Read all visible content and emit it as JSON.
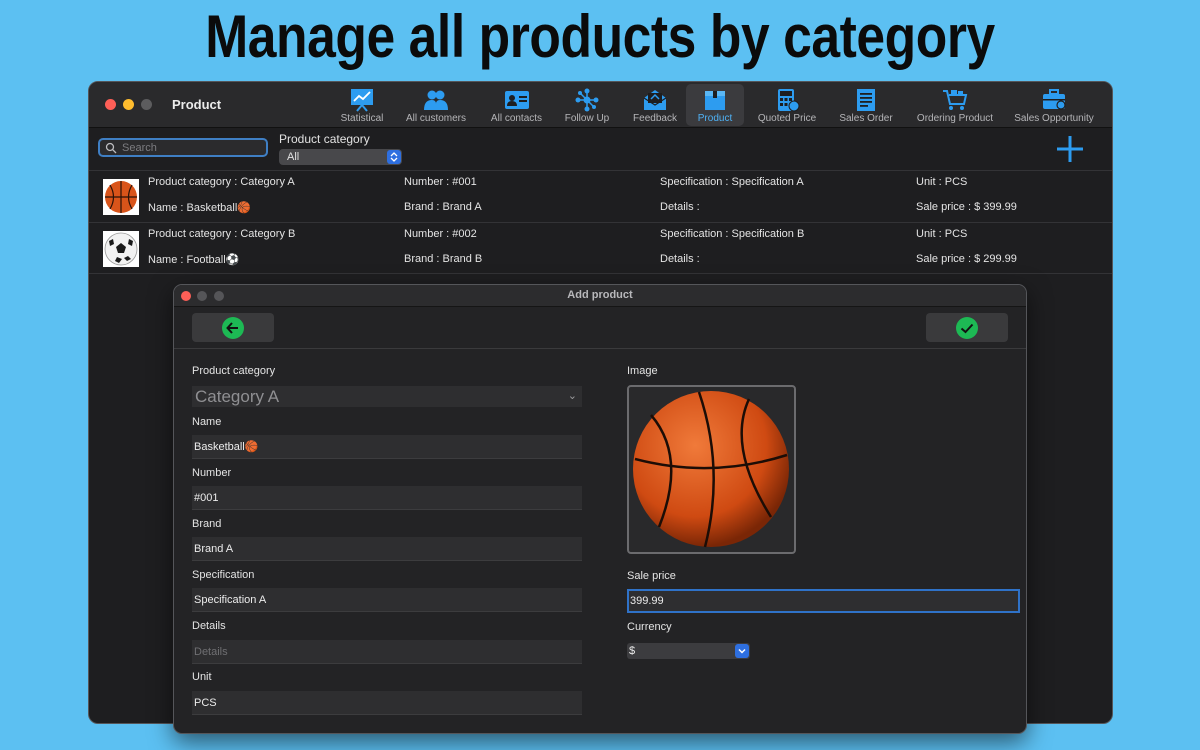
{
  "headline": "Manage all products by category",
  "window": {
    "title": "Product",
    "toolbar": [
      {
        "label": "Statistical",
        "icon": "chart-board-icon"
      },
      {
        "label": "All customers",
        "icon": "customers-icon"
      },
      {
        "label": "All contacts",
        "icon": "contact-card-icon"
      },
      {
        "label": "Follow Up",
        "icon": "network-icon"
      },
      {
        "label": "Feedback",
        "icon": "envelope-icon"
      },
      {
        "label": "Product",
        "icon": "box-icon",
        "active": true
      },
      {
        "label": "Quoted Price",
        "icon": "calculator-icon"
      },
      {
        "label": "Sales Order",
        "icon": "document-list-icon"
      },
      {
        "label": "Ordering Product",
        "icon": "cart-icon"
      },
      {
        "label": "Sales Opportunity",
        "icon": "briefcase-icon"
      }
    ]
  },
  "search": {
    "placeholder": "Search",
    "value": ""
  },
  "filter": {
    "label": "Product category",
    "selected": "All"
  },
  "products": [
    {
      "image": "basketball",
      "category": "Product category : Category A",
      "name": "Name : Basketball🏀",
      "number": "Number : #001",
      "brand": "Brand : Brand A",
      "specification": "Specification : Specification A",
      "details": "Details :",
      "unit": "Unit : PCS",
      "price": "Sale price : $ 399.99"
    },
    {
      "image": "football",
      "category": "Product category : Category B",
      "name": "Name : Football⚽",
      "number": "Number : #002",
      "brand": "Brand : Brand B",
      "specification": "Specification : Specification B",
      "details": "Details :",
      "unit": "Unit : PCS",
      "price": "Sale price : $ 299.99"
    }
  ],
  "dialog": {
    "title": "Add product",
    "fields": {
      "category_label": "Product category",
      "category_value": "Category A",
      "name_label": "Name",
      "name_value": "Basketball🏀",
      "number_label": "Number",
      "number_value": "#001",
      "brand_label": "Brand",
      "brand_value": "Brand A",
      "spec_label": "Specification",
      "spec_value": "Specification A",
      "details_label": "Details",
      "details_placeholder": "Details",
      "unit_label": "Unit",
      "unit_value": "PCS",
      "image_label": "Image",
      "price_label": "Sale price",
      "price_value": "399.99",
      "currency_label": "Currency",
      "currency_value": "$"
    }
  },
  "colors": {
    "background": "#5cc0f2",
    "accent": "#2d9cf0",
    "confirm_green": "#1db954"
  }
}
